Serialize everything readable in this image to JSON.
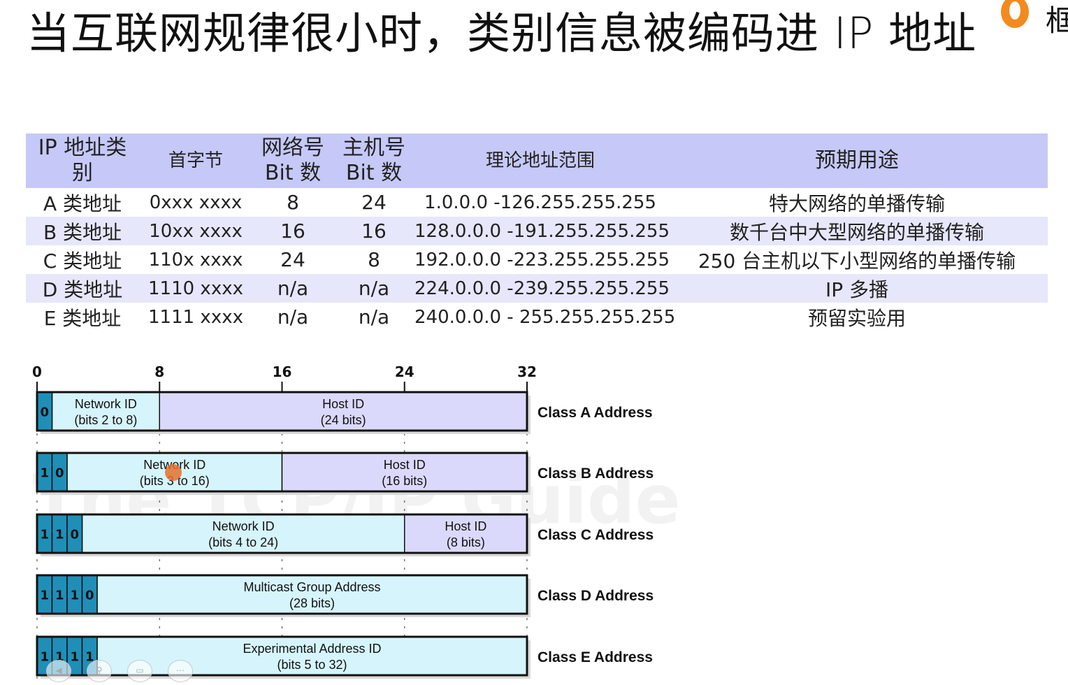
{
  "slide_title": "当互联网规律很小时，类别信息被编码进 IP 地址",
  "logo_text": "框",
  "table": {
    "headers": [
      "IP 地址类别",
      "首字节",
      "网络号 Bit 数",
      "主机号 Bit 数",
      "理论地址范围",
      "预期用途"
    ],
    "rows": [
      [
        "A 类地址",
        "0xxx xxxx",
        "8",
        "24",
        "1.0.0.0 -126.255.255.255",
        "特大网络的单播传输"
      ],
      [
        "B 类地址",
        "10xx xxxx",
        "16",
        "16",
        "128.0.0.0 -191.255.255.255",
        "数千台中大型网络的单播传输"
      ],
      [
        "C 类地址",
        "110x xxxx",
        "24",
        "8",
        "192.0.0.0 -223.255.255.255",
        "250 台主机以下小型网络的单播传输"
      ],
      [
        "D 类地址",
        "1110 xxxx",
        "n/a",
        "n/a",
        "224.0.0.0 -239.255.255.255",
        "IP 多播"
      ],
      [
        "E 类地址",
        "1111 xxxx",
        "n/a",
        "n/a",
        "240.0.0.0 - 255.255.255.255",
        "预留实验用"
      ]
    ]
  },
  "diagram": {
    "scale_ticks": [
      "0",
      "8",
      "16",
      "24",
      "32"
    ],
    "watermark": "The TCP/IP Guide",
    "classes": [
      {
        "label": "Class A Address",
        "prefix": [
          "0"
        ],
        "net_line1": "Network ID",
        "net_line2": "(bits 2 to 8)",
        "net_end_bit": 8,
        "host_line1": "Host ID",
        "host_line2": "(24 bits)"
      },
      {
        "label": "Class B Address",
        "prefix": [
          "1",
          "0"
        ],
        "net_line1": "Network ID",
        "net_line2": "(bits 3 to 16)",
        "net_end_bit": 16,
        "host_line1": "Host ID",
        "host_line2": "(16 bits)"
      },
      {
        "label": "Class C Address",
        "prefix": [
          "1",
          "1",
          "0"
        ],
        "net_line1": "Network ID",
        "net_line2": "(bits 4 to 24)",
        "net_end_bit": 24,
        "host_line1": "Host ID",
        "host_line2": "(8 bits)"
      },
      {
        "label": "Class D Address",
        "prefix": [
          "1",
          "1",
          "1",
          "0"
        ],
        "net_line1": "Multicast Group Address",
        "net_line2": "(28 bits)",
        "net_end_bit": 32,
        "host_line1": "",
        "host_line2": ""
      },
      {
        "label": "Class E Address",
        "prefix": [
          "1",
          "1",
          "1",
          "1"
        ],
        "net_line1": "Experimental Address ID",
        "net_line2": "(bits 5 to 32)",
        "net_end_bit": 32,
        "host_line1": "",
        "host_line2": ""
      }
    ],
    "colors": {
      "prefix": "#1f8fb8",
      "network": "#d6f4fb",
      "host": "#dad9fb",
      "outline": "#111111"
    }
  },
  "player_controls": [
    "prev-icon",
    "zoom-icon",
    "captions-icon",
    "more-icon"
  ]
}
